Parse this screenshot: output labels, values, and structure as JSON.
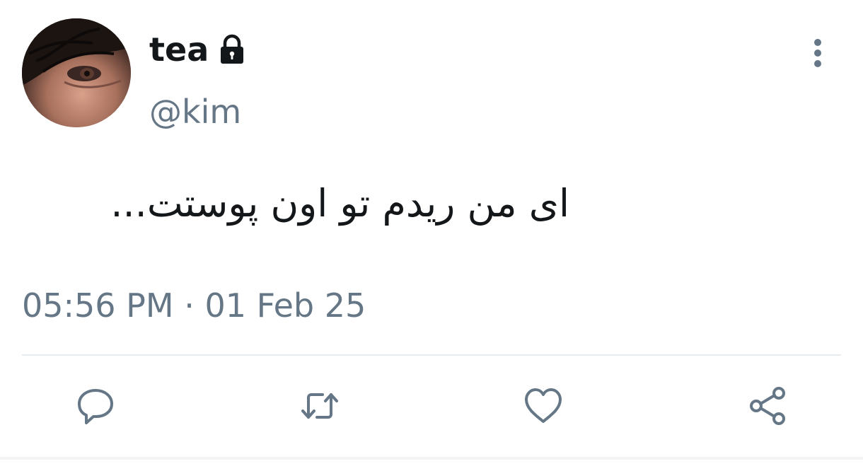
{
  "tweet": {
    "display_name": "tea",
    "handle": "@kim",
    "protected_icon": "lock-icon",
    "text": "ای من ریدم تو اون پوستت...",
    "timestamp": "05:56 PM · 01 Feb 25"
  },
  "actions": [
    {
      "name": "reply",
      "icon": "reply-icon"
    },
    {
      "name": "retweet",
      "icon": "retweet-icon"
    },
    {
      "name": "like",
      "icon": "heart-icon"
    },
    {
      "name": "share",
      "icon": "share-icon"
    }
  ],
  "colors": {
    "text_primary": "#14171a",
    "text_secondary": "#657786",
    "divider": "#e6ecf0"
  }
}
